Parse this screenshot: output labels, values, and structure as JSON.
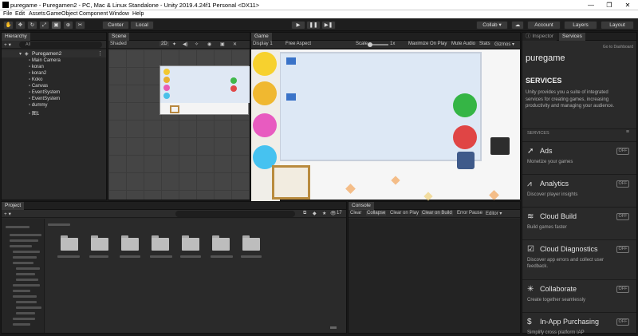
{
  "window": {
    "title": "puregame - Puregamen2 - PC, Mac & Linux Standalone - Unity 2019.4.24f1 Personal <DX11>",
    "minimize": "—",
    "maximize": "❐",
    "close": "✕"
  },
  "menu": [
    "File",
    "Edit",
    "Assets",
    "GameObject",
    "Component",
    "Window",
    "Help"
  ],
  "toolbar": {
    "center": "Center",
    "local": "Local",
    "play": "▶",
    "pause": "❚❚",
    "step": "▶❚",
    "collab": "Collab ▾",
    "account": "Account",
    "layers": "Layers",
    "layout": "Layout"
  },
  "hierarchy": {
    "tab": "Hierarchy",
    "create": "+ ▾",
    "search": "All",
    "scene": "Puregamen2",
    "items": [
      "Main Camera",
      "koran",
      "koran2",
      "Koko",
      "Canvas",
      "EventSystem",
      "EventSystem",
      "dummy",
      "图1"
    ]
  },
  "scene": {
    "tab": "Scene",
    "shading": "Shaded",
    "mode2d": "2D"
  },
  "game": {
    "tab": "Game",
    "display": "Display 1",
    "aspect": "Free Aspect",
    "scale_label": "Scale",
    "scale_value": "1x",
    "maximize": "Maximize On Play",
    "mute": "Mute Audio",
    "stats": "Stats",
    "gizmos": "Gizmos ▾"
  },
  "project": {
    "tab": "Project",
    "create": "+ ▾",
    "count": "17"
  },
  "console": {
    "tab": "Console",
    "buttons": [
      "Clear",
      "Collapse",
      "Clear on Play",
      "Clear on Build",
      "Error Pause",
      "Editor ▾"
    ]
  },
  "inspector": {
    "tab_inspector": "Inspector",
    "tab_services": "Services",
    "dashboard": "Go to Dashboard",
    "project_name": "puregame",
    "heading": "SERVICES",
    "intro": "Unity provides you a suite of integrated services for creating games, increasing productivity and managing your audience.",
    "section": "SERVICES",
    "services": [
      {
        "name": "Ads",
        "desc": "Monetize your games",
        "state": "OFF",
        "icon": "ads-icon",
        "glyph": "➚"
      },
      {
        "name": "Analytics",
        "desc": "Discover player insights",
        "state": "OFF",
        "icon": "analytics-icon",
        "glyph": "⩘"
      },
      {
        "name": "Cloud Build",
        "desc": "Build games faster",
        "state": "OFF",
        "icon": "cloud-build-icon",
        "glyph": "≋"
      },
      {
        "name": "Cloud Diagnostics",
        "desc": "Discover app errors and collect user feedback.",
        "state": "OFF",
        "icon": "cloud-diagnostics-icon",
        "glyph": "☑"
      },
      {
        "name": "Collaborate",
        "desc": "Create together seamlessly",
        "state": "OFF",
        "icon": "collaborate-icon",
        "glyph": "✳"
      },
      {
        "name": "In-App Purchasing",
        "desc": "Simplify cross platform IAP",
        "state": "OFF",
        "icon": "iap-icon",
        "glyph": "$"
      }
    ]
  }
}
